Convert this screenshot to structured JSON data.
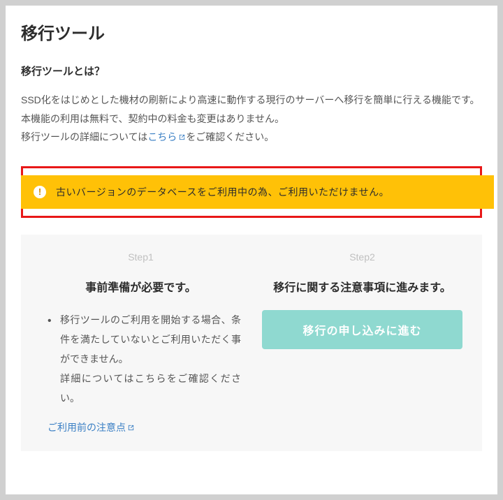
{
  "page": {
    "title": "移行ツール",
    "subtitle": "移行ツールとは？",
    "description_line1": "SSD化をはじめとした機材の刷新により高速に動作する現行のサーバーへ移行を簡単に行える機能です。",
    "description_line2": "本機能の利用は無料で、契約中の料金も変更はありません。",
    "description_line3_prefix": "移行ツールの詳細については",
    "description_line3_link": "こちら",
    "description_line3_suffix": "をご確認ください。"
  },
  "alert": {
    "message": "古いバージョンのデータベースをご利用中の為、ご利用いただけません。"
  },
  "steps": {
    "step1": {
      "label": "Step1",
      "title": "事前準備が必要です。",
      "item1": "移行ツールのご利用を開始する場合、条件を満たしていないとご利用いただく事ができません。",
      "item2": "詳細についてはこちらをご確認ください。",
      "link": "ご利用前の注意点"
    },
    "step2": {
      "label": "Step2",
      "title": "移行に関する注意事項に進みます。",
      "button": "移行の申し込みに進む"
    }
  }
}
